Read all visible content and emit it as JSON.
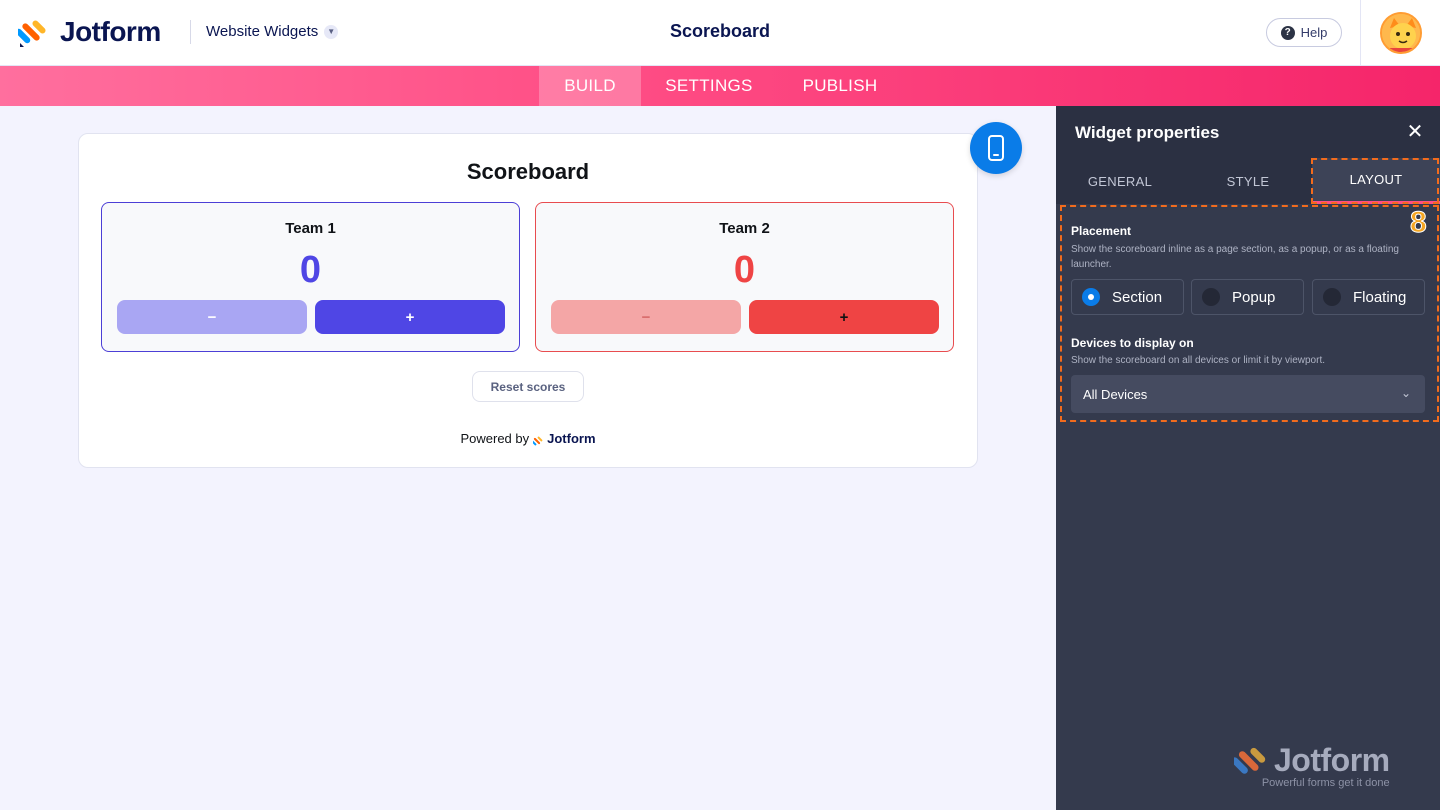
{
  "header": {
    "brand": "Jotform",
    "product": "Website Widgets",
    "page_title": "Scoreboard",
    "help_label": "Help"
  },
  "nav": {
    "tabs": [
      {
        "label": "BUILD",
        "active": true
      },
      {
        "label": "SETTINGS",
        "active": false
      },
      {
        "label": "PUBLISH",
        "active": false
      }
    ]
  },
  "preview": {
    "title": "Scoreboard",
    "teams": [
      {
        "name": "Team 1",
        "score": "0",
        "minus": "−",
        "plus": "+",
        "color": "#4f46e5"
      },
      {
        "name": "Team 2",
        "score": "0",
        "minus": "−",
        "plus": "+",
        "color": "#ef4444"
      }
    ],
    "reset_label": "Reset scores",
    "powered_by": "Powered by",
    "powered_brand": "Jotform"
  },
  "panel": {
    "title": "Widget properties",
    "tabs": [
      {
        "label": "GENERAL",
        "active": false
      },
      {
        "label": "STYLE",
        "active": false
      },
      {
        "label": "LAYOUT",
        "active": true
      }
    ],
    "step_number": "8",
    "placement": {
      "label": "Placement",
      "description": "Show the scoreboard inline as a page section, as a popup, or as a floating launcher.",
      "options": [
        {
          "label": "Section",
          "selected": true
        },
        {
          "label": "Popup",
          "selected": false
        },
        {
          "label": "Floating",
          "selected": false
        }
      ]
    },
    "devices": {
      "label": "Devices to display on",
      "description": "Show the scoreboard on all devices or limit it by viewport.",
      "value": "All Devices"
    }
  },
  "watermark": {
    "brand": "Jotform",
    "tagline": "Powerful forms get it done"
  },
  "colors": {
    "accent_pink": "#ff4f86",
    "primary_blue": "#0a7ce8",
    "highlight_orange": "#f26b1d"
  }
}
